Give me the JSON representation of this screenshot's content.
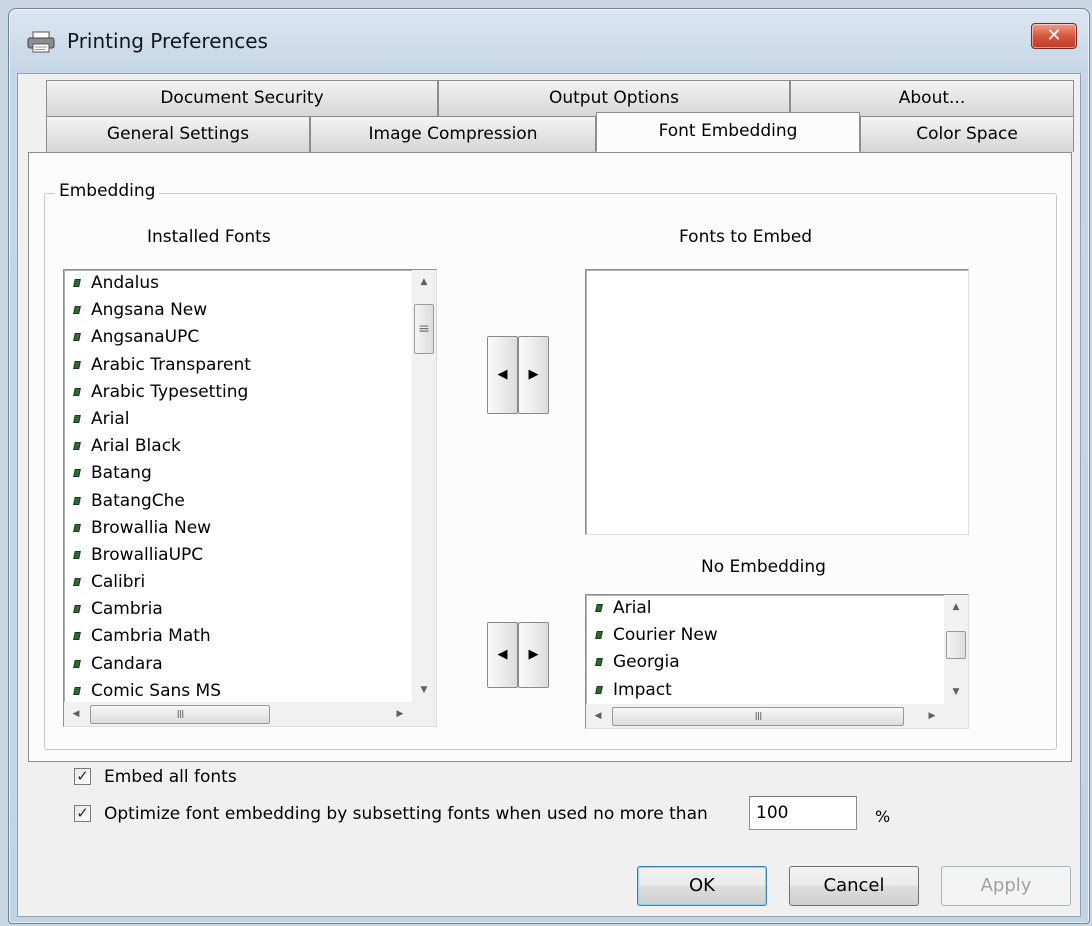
{
  "window": {
    "title": "Printing Preferences",
    "close_glyph": "✕"
  },
  "tabs": {
    "row1": [
      {
        "label": "Document Security"
      },
      {
        "label": "Output Options"
      },
      {
        "label": "About..."
      }
    ],
    "row2": [
      {
        "label": "General Settings"
      },
      {
        "label": "Image Compression"
      },
      {
        "label": "Font Embedding",
        "active": true
      },
      {
        "label": "Color Space"
      }
    ]
  },
  "embedding": {
    "group_title": "Embedding",
    "installed_label": "Installed Fonts",
    "to_embed_label": "Fonts to Embed",
    "no_embed_label": "No Embedding",
    "installed_fonts": [
      "Andalus",
      "Angsana New",
      "AngsanaUPC",
      "Arabic Transparent",
      "Arabic Typesetting",
      "Arial",
      "Arial Black",
      "Batang",
      "BatangChe",
      "Browallia New",
      "BrowalliaUPC",
      "Calibri",
      "Cambria",
      "Cambria Math",
      "Candara",
      "Comic Sans MS"
    ],
    "fonts_to_embed": [],
    "no_embedding_fonts": [
      "Arial",
      "Courier New",
      "Georgia",
      "Impact"
    ],
    "scroll_thumb_grip": "≡",
    "hscroll_thumb_grip": "III",
    "arrow_left": "◀",
    "arrow_right": "▶",
    "arrow_up": "▲",
    "arrow_down": "▼"
  },
  "options": {
    "embed_all_label": "Embed all fonts",
    "embed_all_checked": true,
    "optimize_label": "Optimize font embedding by subsetting fonts when used no more than",
    "optimize_checked": true,
    "threshold_value": "100",
    "percent_label": "%",
    "check_glyph": "✓"
  },
  "buttons": {
    "ok": "OK",
    "cancel": "Cancel",
    "apply": "Apply"
  },
  "colors": {
    "close_button": "#c13b22",
    "bullet": "#2e6b2e",
    "default_button_border": "#3c7fb1"
  }
}
